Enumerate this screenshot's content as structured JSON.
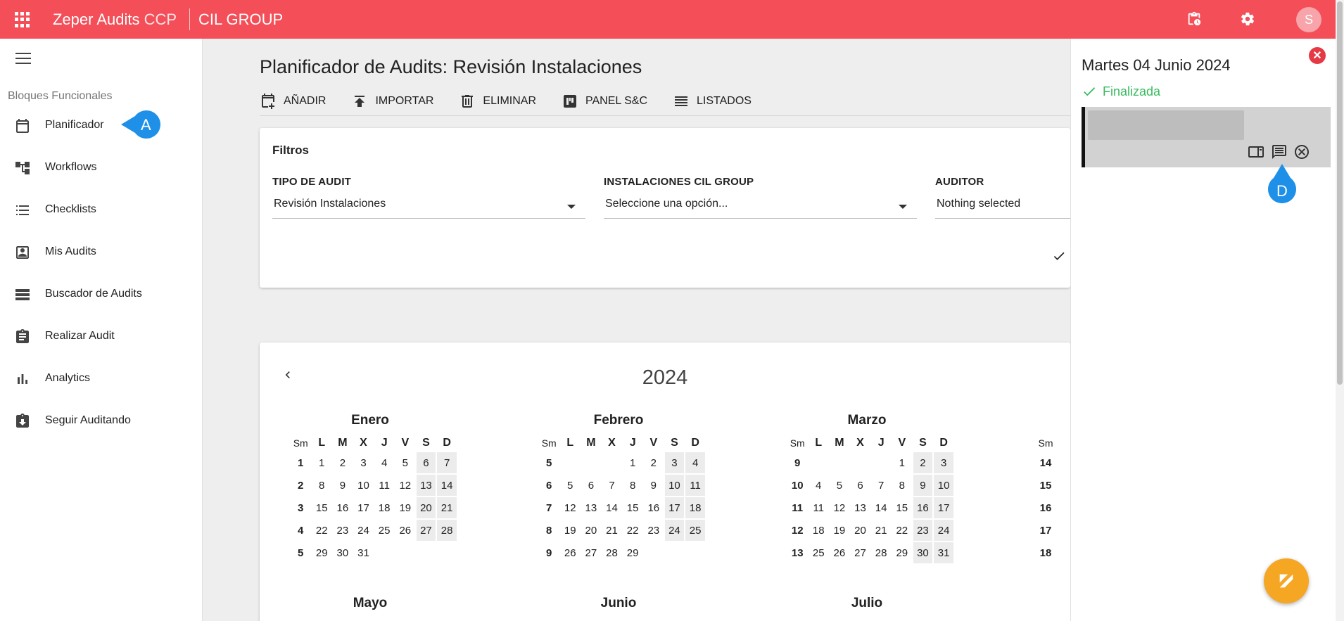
{
  "header": {
    "brand_main": "Zeper Audits",
    "brand_suffix": "CCP",
    "company": "CIL GROUP",
    "avatar_letter": "S",
    "bg_color": "#f44e58"
  },
  "sidebar": {
    "section_title": "Bloques Funcionales",
    "items": [
      {
        "label": "Planificador",
        "icon": "calendar-icon"
      },
      {
        "label": "Workflows",
        "icon": "workflow-icon"
      },
      {
        "label": "Checklists",
        "icon": "checklist-icon"
      },
      {
        "label": "Mis Audits",
        "icon": "person-box-icon"
      },
      {
        "label": "Buscador de Audits",
        "icon": "list-search-icon"
      },
      {
        "label": "Realizar Audit",
        "icon": "clipboard-icon"
      },
      {
        "label": "Analytics",
        "icon": "bar-chart-icon"
      },
      {
        "label": "Seguir Auditando",
        "icon": "download-box-icon"
      }
    ],
    "marker_a": "A"
  },
  "main": {
    "title": "Planificador de Audits: Revisión Instalaciones",
    "actions": [
      "AÑADIR",
      "IMPORTAR",
      "ELIMINAR",
      "PANEL S&C",
      "LISTADOS"
    ]
  },
  "filters": {
    "title": "Filtros",
    "tipo_label": "TIPO DE AUDIT",
    "tipo_value": "Revisión Instalaciones",
    "inst_label": "INSTALACIONES CIL GROUP",
    "inst_value": "Seleccione una opción...",
    "auditor_label": "AUDITOR",
    "auditor_value": "Nothing selected"
  },
  "calendar": {
    "year": "2024",
    "weekday_headers": [
      "Sm",
      "L",
      "M",
      "X",
      "J",
      "V",
      "S",
      "D"
    ],
    "months": [
      {
        "name": "Enero",
        "weeks": [
          [
            "1",
            "1",
            "2",
            "3",
            "4",
            "5",
            "6",
            "7"
          ],
          [
            "2",
            "8",
            "9",
            "10",
            "11",
            "12",
            "13",
            "14"
          ],
          [
            "3",
            "15",
            "16",
            "17",
            "18",
            "19",
            "20",
            "21"
          ],
          [
            "4",
            "22",
            "23",
            "24",
            "25",
            "26",
            "27",
            "28"
          ],
          [
            "5",
            "29",
            "30",
            "31",
            "",
            "",
            "",
            ""
          ]
        ]
      },
      {
        "name": "Febrero",
        "weeks": [
          [
            "5",
            "",
            "",
            "",
            "1",
            "2",
            "3",
            "4"
          ],
          [
            "6",
            "5",
            "6",
            "7",
            "8",
            "9",
            "10",
            "11"
          ],
          [
            "7",
            "12",
            "13",
            "14",
            "15",
            "16",
            "17",
            "18"
          ],
          [
            "8",
            "19",
            "20",
            "21",
            "22",
            "23",
            "24",
            "25"
          ],
          [
            "9",
            "26",
            "27",
            "28",
            "29",
            "",
            "",
            ""
          ]
        ]
      },
      {
        "name": "Marzo",
        "weeks": [
          [
            "9",
            "",
            "",
            "",
            "",
            "1",
            "2",
            "3"
          ],
          [
            "10",
            "4",
            "5",
            "6",
            "7",
            "8",
            "9",
            "10"
          ],
          [
            "11",
            "11",
            "12",
            "13",
            "14",
            "15",
            "16",
            "17"
          ],
          [
            "12",
            "18",
            "19",
            "20",
            "21",
            "22",
            "23",
            "24"
          ],
          [
            "13",
            "25",
            "26",
            "27",
            "28",
            "29",
            "30",
            "31"
          ]
        ]
      },
      {
        "name": "",
        "weeks": [
          [
            "14"
          ],
          [
            "15"
          ],
          [
            "16"
          ],
          [
            "17"
          ],
          [
            "18"
          ]
        ]
      }
    ],
    "next_row": [
      "Mayo",
      "Junio",
      "Julio"
    ]
  },
  "panel": {
    "date": "Martes 04 Junio 2024",
    "status": "Finalizada",
    "status_color": "#3aba60",
    "marker_d": "D"
  }
}
